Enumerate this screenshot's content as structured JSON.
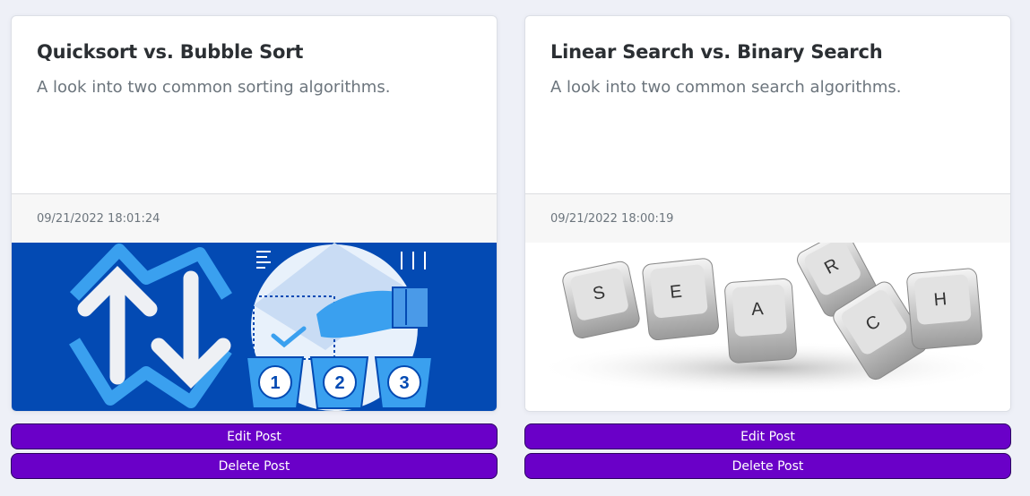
{
  "posts": [
    {
      "title": "Quicksort vs. Bubble Sort",
      "description": "A look into two common sorting algorithms.",
      "timestamp": "09/21/2022 18:01:24",
      "image": {
        "subject": "sorting illustration",
        "badges": [
          "1",
          "2",
          "3"
        ],
        "colors": {
          "bg": "#034ab3",
          "light": "#e8f1fb",
          "accent": "#3aa0ef"
        }
      },
      "edit_label": "Edit Post",
      "delete_label": "Delete Post"
    },
    {
      "title": "Linear Search vs. Binary Search",
      "description": "A look into two common search algorithms.",
      "timestamp": "09/21/2022 18:00:19",
      "image": {
        "subject": "keyboard keys spelling search",
        "keys": [
          "S",
          "E",
          "A",
          "R",
          "C",
          "H"
        ]
      },
      "edit_label": "Edit Post",
      "delete_label": "Delete Post"
    }
  ],
  "colors": {
    "button": "#6a00c8",
    "button_border": "#2a0060",
    "page_bg": "#eef0f7"
  }
}
